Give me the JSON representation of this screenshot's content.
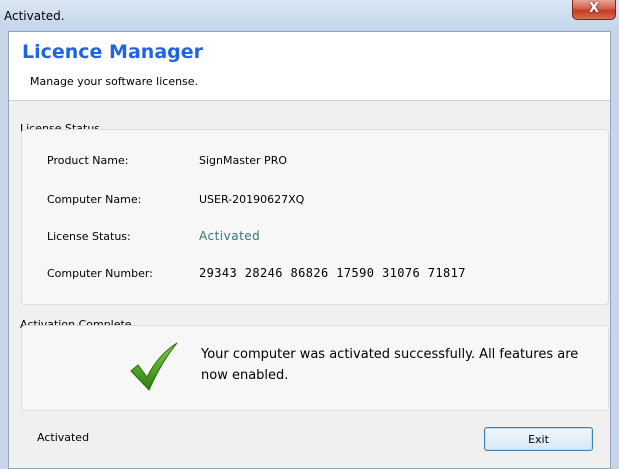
{
  "window": {
    "title": "Activated.",
    "close_label": "X"
  },
  "header": {
    "title": "Licence Manager",
    "subtitle": "Manage your software license."
  },
  "license_status": {
    "group_label": "License Status",
    "rows": [
      {
        "label": "Product Name:",
        "value": "SignMaster PRO"
      },
      {
        "label": "Computer Name:",
        "value": "USER-20190627XQ"
      },
      {
        "label": "License Status:",
        "value": "Activated"
      },
      {
        "label": "Computer Number:",
        "value": "29343 28246 86826 17590 31076 71817"
      }
    ]
  },
  "activation": {
    "group_label": "Activation Complete",
    "message": "Your computer was activated successfully. All features are now enabled.",
    "icon": "checkmark-icon"
  },
  "footer": {
    "status_text": "Activated",
    "exit_label": "Exit"
  },
  "colors": {
    "title_blue": "#1f63e6",
    "status_teal": "#3a7575",
    "check_green": "#3f9a1f"
  }
}
